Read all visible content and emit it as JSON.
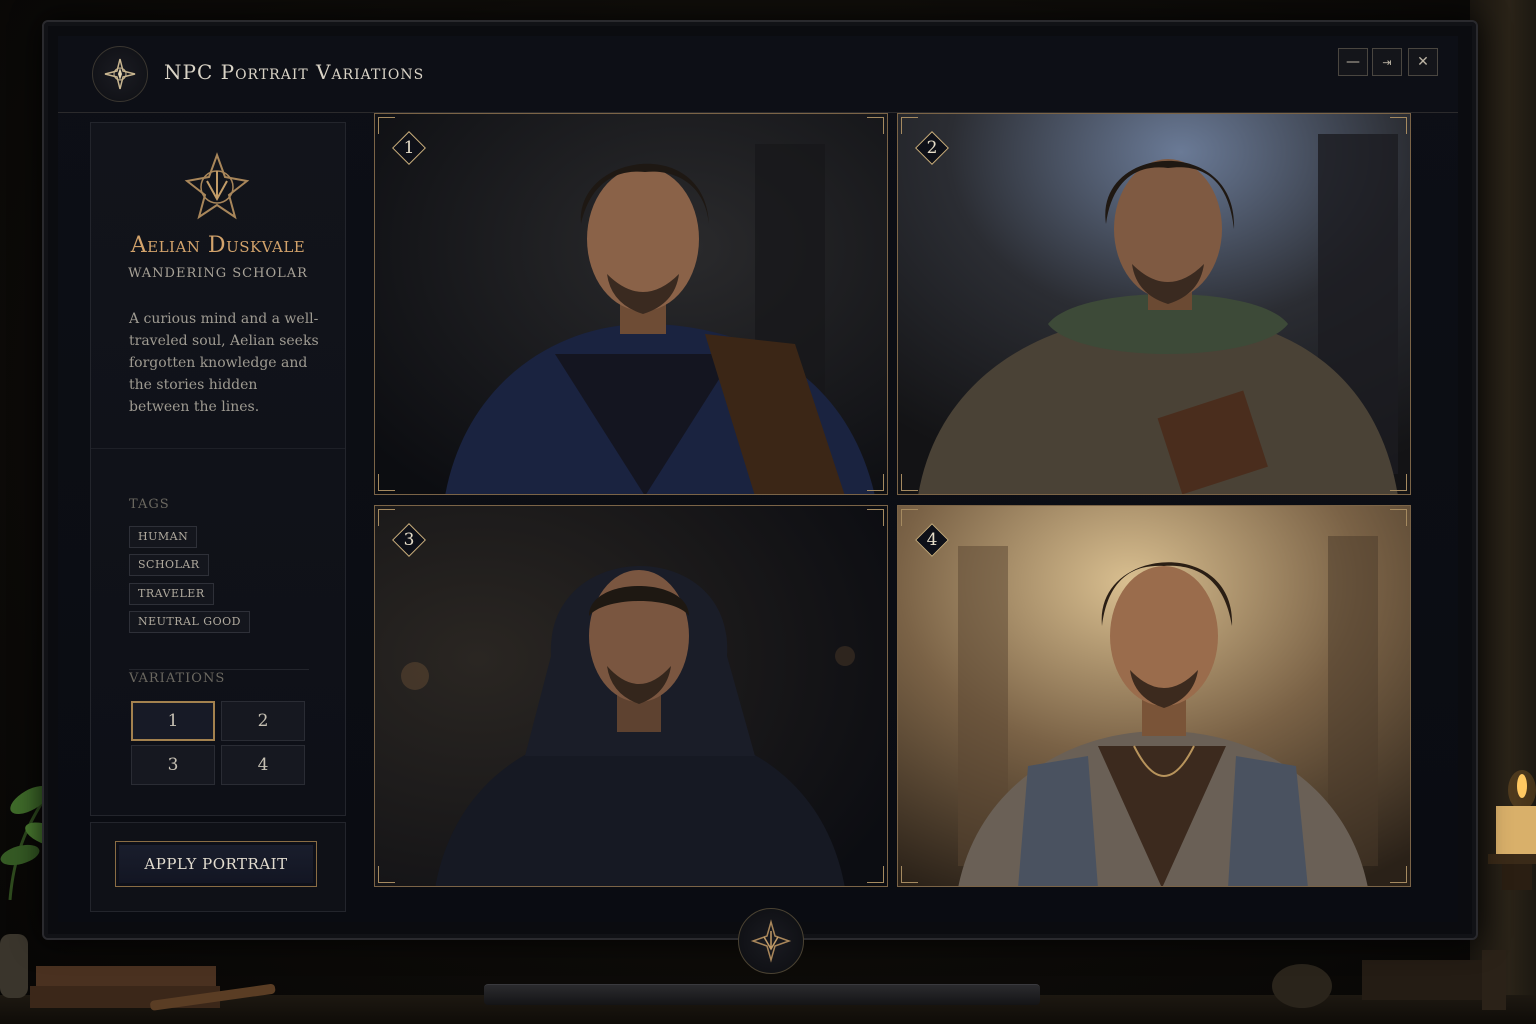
{
  "window": {
    "title": "NPC Portrait Variations",
    "minimize_icon": "minimize-icon",
    "restore_icon": "restore-icon",
    "close_icon": "close-icon"
  },
  "npc": {
    "name": "Aelian Duskvale",
    "class": "WANDERING SCHOLAR",
    "description": "A curious mind and a well-traveled soul, Aelian seeks forgotten knowledge and the stories hidden between the lines."
  },
  "tags": {
    "label": "TAGS",
    "items": [
      "HUMAN",
      "SCHOLAR",
      "TRAVELER",
      "NEUTRAL GOOD"
    ]
  },
  "variations": {
    "label": "VARIATIONS",
    "options": [
      "1",
      "2",
      "3",
      "4"
    ],
    "selected": "1"
  },
  "actions": {
    "apply_label": "APPLY PORTRAIT"
  },
  "portraits": [
    {
      "number": "1",
      "outfit": "navy-coat",
      "background": "dark-library"
    },
    {
      "number": "2",
      "outfit": "green-scarf-with-book",
      "background": "misty-archway"
    },
    {
      "number": "3",
      "outfit": "dark-hood",
      "background": "dark-alley"
    },
    {
      "number": "4",
      "outfit": "open-shirt-necklace",
      "background": "warm-sunlit-ruins"
    }
  ],
  "colors": {
    "accent_gold": "#a3814e",
    "name_gold": "#d3a36b",
    "panel_bg": "#0d0f16"
  }
}
